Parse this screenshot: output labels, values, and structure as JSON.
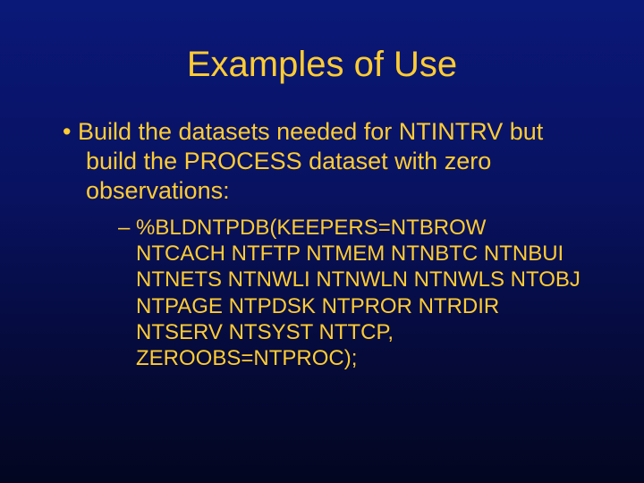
{
  "title": "Examples of Use",
  "bullet_main": "Build the datasets needed for NTINTRV but build the PROCESS dataset with zero observations:",
  "bullet_sub": "%BLDNTPDB(KEEPERS=NTBROW NTCACH NTFTP NTMEM NTNBTC NTNBUI NTNETS NTNWLI NTNWLN NTNWLS NTOBJ NTPAGE NTPDSK NTPROR NTRDIR NTSERV NTSYST NTTCP, ZEROOBS=NTPROC);"
}
